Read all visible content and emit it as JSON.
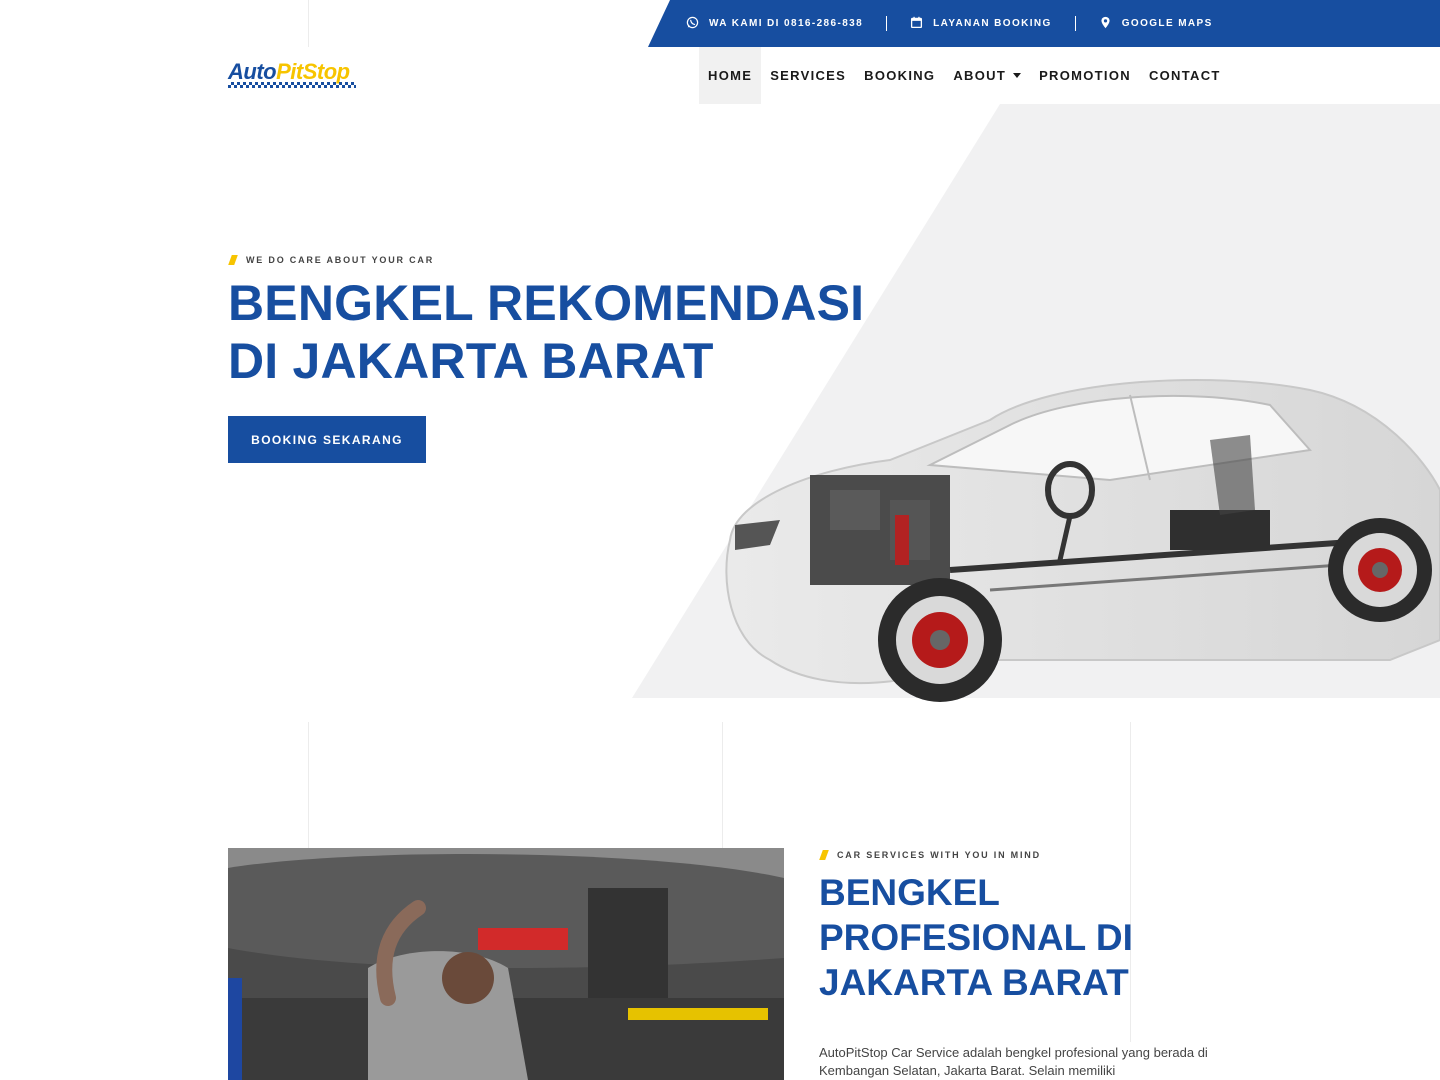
{
  "topbar": {
    "items": [
      {
        "icon": "whatsapp-icon",
        "label": "WA KAMI DI 0816-286-838"
      },
      {
        "icon": "calendar-icon",
        "label": "LAYANAN BOOKING"
      },
      {
        "icon": "map-pin-icon",
        "label": "GOOGLE MAPS"
      }
    ]
  },
  "logo": {
    "part1": "Auto",
    "part2": "PitStop"
  },
  "nav": {
    "items": [
      {
        "label": "HOME",
        "active": true
      },
      {
        "label": "SERVICES"
      },
      {
        "label": "BOOKING"
      },
      {
        "label": "ABOUT",
        "dropdown": true
      },
      {
        "label": "PROMOTION"
      },
      {
        "label": "CONTACT"
      }
    ]
  },
  "hero": {
    "tagline": "WE DO CARE ABOUT YOUR CAR",
    "title_line1": "BENGKEL REKOMENDASI",
    "title_line2": "DI JAKARTA BARAT",
    "cta": "BOOKING SEKARANG"
  },
  "about": {
    "tagline": "CAR SERVICES WITH YOU IN MIND",
    "title_line1": "BENGKEL",
    "title_line2": "PROFESIONAL DI",
    "title_line3": "JAKARTA BARAT",
    "text": "AutoPitStop Car Service adalah bengkel profesional yang berada di Kembangan Selatan, Jakarta Barat. Selain memiliki"
  },
  "colors": {
    "brand_blue": "#174ea0",
    "accent_yellow": "#f7c400",
    "hero_bg": "#f1f1f2"
  }
}
